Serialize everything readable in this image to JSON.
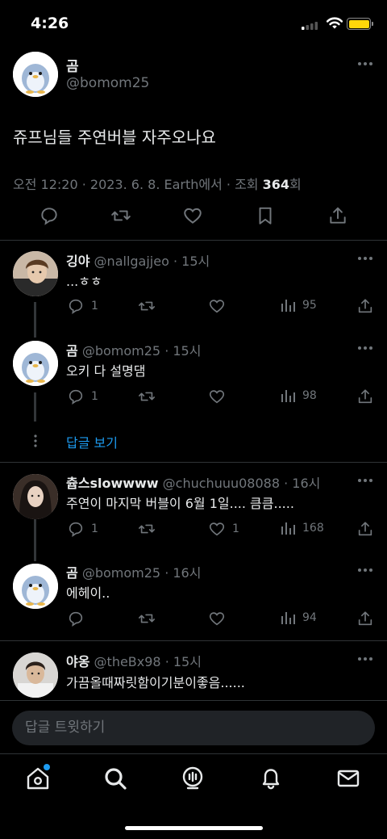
{
  "status_bar": {
    "time": "4:26"
  },
  "main_tweet": {
    "name": "곰",
    "handle": "@bomom25",
    "text": "쥬프님들 주연버블 자주오나요",
    "meta_prefix": "오전 12:20 · 2023. 6. 8. Earth에서 · 조회 ",
    "views": "364",
    "views_suffix": "회"
  },
  "replies": [
    {
      "name": "깅야",
      "handle": "@nallgajjeo",
      "time": "· 15시",
      "text": "...ㅎㅎ",
      "replies_count": "1",
      "likes_count": "",
      "views_count": "95"
    },
    {
      "name": "곰",
      "handle": "@bomom25",
      "time": "· 15시",
      "text": "오키 다 설명댐",
      "replies_count": "1",
      "likes_count": "",
      "views_count": "98"
    },
    {
      "name": "츕스slowwww",
      "handle": "@chuchuuu08088",
      "time": "· 16시",
      "text": "주연이 마지막 버블이 6월 1일.... 큼큼.....",
      "replies_count": "1",
      "likes_count": "1",
      "views_count": "168"
    },
    {
      "name": "곰",
      "handle": "@bomom25",
      "time": "· 16시",
      "text": "에헤이..",
      "replies_count": "",
      "likes_count": "",
      "views_count": "94"
    },
    {
      "name": "야옹",
      "handle": "@theBx98",
      "time": "· 15시",
      "text": "가끔올때짜릿함이기분이좋음......"
    }
  ],
  "show_replies_label": "답글 보기",
  "reply_input_placeholder": "답글 트윗하기",
  "tabs": [
    "home-icon",
    "search-icon",
    "spaces-icon",
    "notifications-icon",
    "messages-icon"
  ],
  "colors": {
    "accent": "#1d9bf0",
    "muted": "#71767b",
    "background": "#000000",
    "battery": "#ffd60a"
  }
}
